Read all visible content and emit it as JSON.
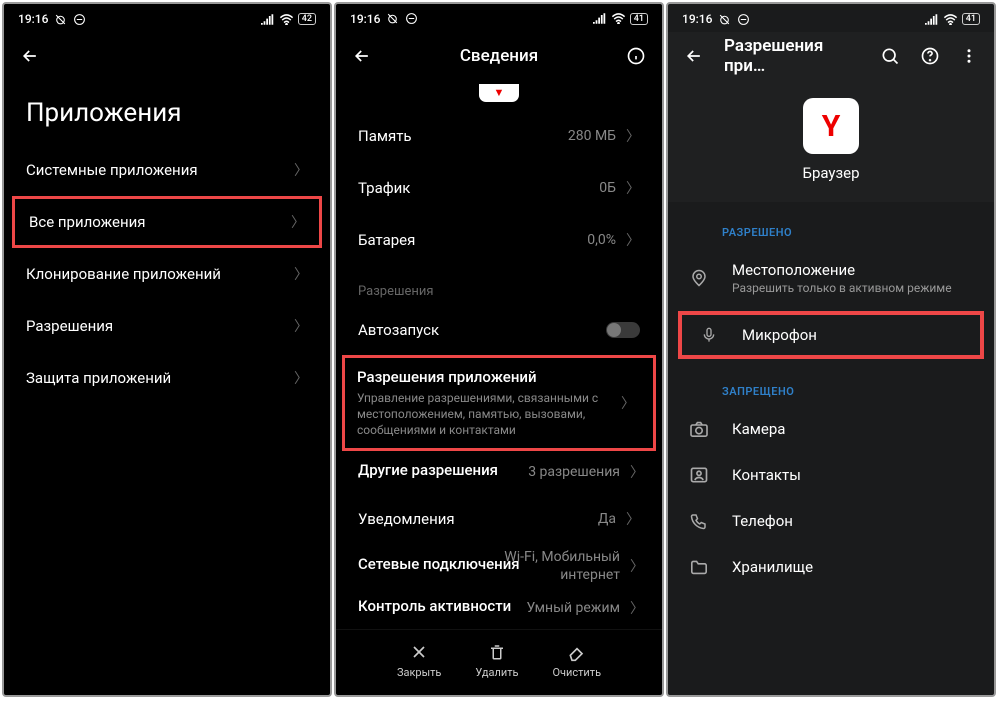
{
  "statusbar": {
    "time": "19:16",
    "battery1": "42",
    "battery2": "41",
    "battery3": "41"
  },
  "screen1": {
    "title": "Приложения",
    "items": {
      "system": "Системные приложения",
      "all": "Все приложения",
      "clone": "Клонирование приложений",
      "perms": "Разрешения",
      "protect": "Защита приложений"
    }
  },
  "screen2": {
    "title": "Сведения",
    "storage": {
      "label": "Память",
      "value": "280 МБ"
    },
    "traffic": {
      "label": "Трафик",
      "value": "0Б"
    },
    "battery": {
      "label": "Батарея",
      "value": "0,0%"
    },
    "section_perm": "Разрешения",
    "autostart": "Автозапуск",
    "appperms": {
      "label": "Разрешения приложений",
      "sub": "Управление разрешениями, связанными с местоположением, памятью, вызовами, сообщениями и контактами"
    },
    "other": {
      "label": "Другие разрешения",
      "value": "3 разрешения"
    },
    "notif": {
      "label": "Уведомления",
      "value": "Да"
    },
    "net": {
      "label": "Сетевые подключения",
      "value": "Wi-Fi, Мобильный интернет"
    },
    "activity": {
      "label": "Контроль активности",
      "value": "Умный режим"
    },
    "bottom": {
      "close": "Закрыть",
      "delete": "Удалить",
      "clear": "Очистить"
    }
  },
  "screen3": {
    "title": "Разрешения при…",
    "appname": "Браузер",
    "appletter": "Y",
    "allowed": "Разрешено",
    "location": {
      "label": "Местоположение",
      "sub": "Разрешить только в активном режиме"
    },
    "mic": "Микрофон",
    "denied": "Запрещено",
    "camera": "Камера",
    "contacts": "Контакты",
    "phone": "Телефон",
    "storage": "Хранилище"
  }
}
